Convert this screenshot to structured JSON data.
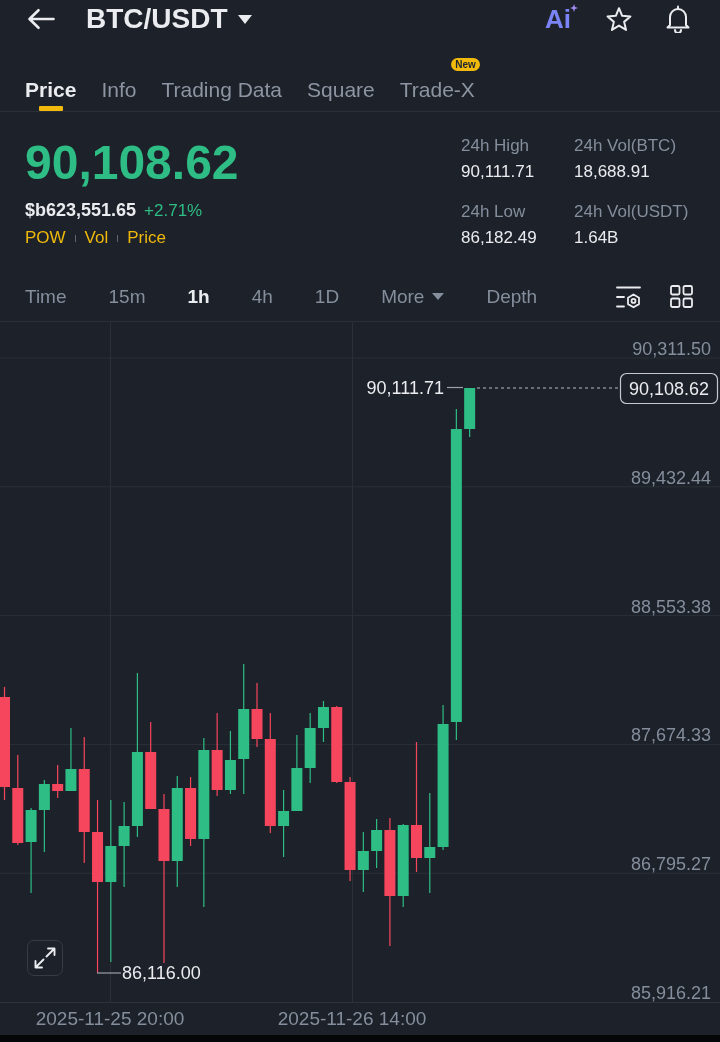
{
  "header": {
    "title": "BTC/USDT",
    "ai_label": "Ai"
  },
  "tabs": [
    {
      "label": "Price",
      "selected": true
    },
    {
      "label": "Info",
      "selected": false
    },
    {
      "label": "Trading Data",
      "selected": false
    },
    {
      "label": "Square",
      "selected": false
    },
    {
      "label": "Trade-X",
      "selected": false,
      "badge": "New"
    }
  ],
  "ticker": {
    "last_price": "90,108.62",
    "price_in_currency": "$b623,551.65",
    "change": "+2.71%",
    "indicators": [
      "POW",
      "Vol",
      "Price"
    ],
    "stats": [
      {
        "label": "24h High",
        "value": "90,111.71"
      },
      {
        "label": "24h Vol(BTC)",
        "value": "18,688.91"
      },
      {
        "label": "24h Low",
        "value": "86,182.49"
      },
      {
        "label": "24h Vol(USDT)",
        "value": "1.64B"
      }
    ]
  },
  "intervals": [
    {
      "label": "Time",
      "kind": "option",
      "selected": false
    },
    {
      "label": "15m",
      "kind": "option",
      "selected": false
    },
    {
      "label": "1h",
      "kind": "option",
      "selected": true
    },
    {
      "label": "4h",
      "kind": "option",
      "selected": false
    },
    {
      "label": "1D",
      "kind": "option",
      "selected": false
    },
    {
      "label": "More",
      "kind": "dropdown",
      "selected": false
    },
    {
      "label": "Depth",
      "kind": "option",
      "selected": false
    }
  ],
  "chart": {
    "y_axis_labels": [
      "90,311.50",
      "89,432.44",
      "88,553.38",
      "87,674.33",
      "86,795.27",
      "85,916.21"
    ],
    "x_axis_labels": [
      "2025-11-25 20:00",
      "2025-11-26 14:00"
    ],
    "high_label": "90,111.71",
    "low_label": "86,116.00",
    "last_price_label": "90,108.62"
  }
}
